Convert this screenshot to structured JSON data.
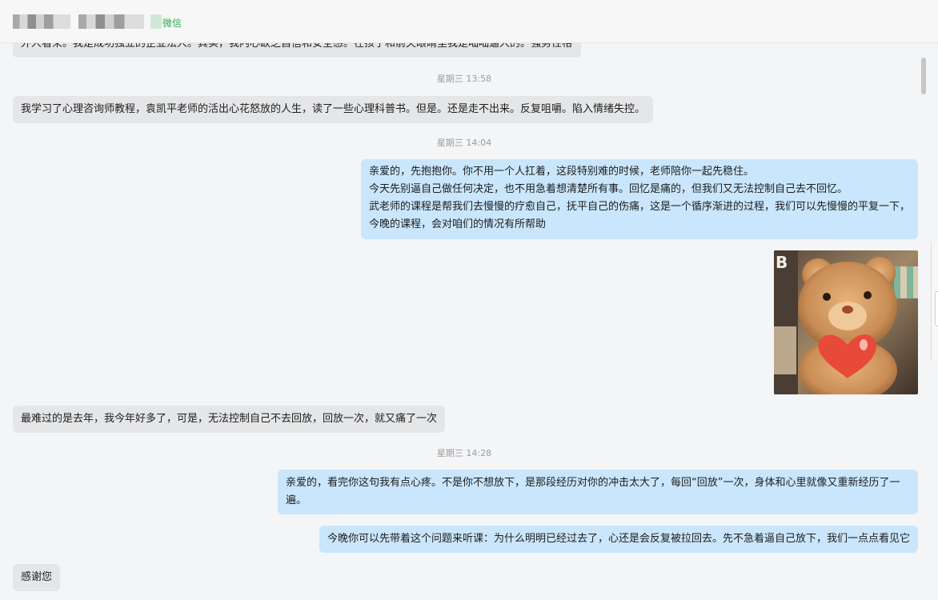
{
  "header": {
    "source_label": "微信"
  },
  "messages": {
    "m0": "外人看来。我是成功独立的企业法人。其实，我内心缺乏自信和安全感。在孩子和前夫眼睛里我是咄咄逼人的。强势性格",
    "t1": "星期三 13:58",
    "m1": "我学习了心理咨询师教程，袁凯平老师的活出心花怒放的人生，读了一些心理科普书。但是。还是走不出来。反复咀嚼。陷入情绪失控。",
    "t2": "星期三 14:04",
    "m2": "亲爱的，先抱抱你。你不用一个人扛着，这段特别难的时候，老师陪你一起先稳住。\n今天先别逼自己做任何决定，也不用急着想清楚所有事。回忆是痛的，但我们又无法控制自己去不回忆。\n武老师的课程是帮我们去慢慢的疗愈自己，抚平自己的伤痛，这是一个循序渐进的过程，我们可以先慢慢的平复一下，\n今晚的课程，会对咱们的情况有所帮助",
    "m3": "最难过的是去年，我今年好多了，可是，无法控制自己不去回放，回放一次，就又痛了一次",
    "t3": "星期三 14:28",
    "m4": "亲爱的，看完你这句我有点心疼。不是你不想放下，是那段经历对你的冲击太大了，每回“回放”一次，身体和心里就像又重新经历了一遍。",
    "m5": "今晚你可以先带着这个问题来听课：为什么明明已经过去了，心还是会反复被拉回去。先不急着逼自己放下，我们一点点看见它",
    "m6": "感谢您"
  },
  "sticker": {
    "description_icon": "teddy-bear-heart-sticker"
  },
  "colors": {
    "incoming_bubble": "#e5e6e8",
    "outgoing_bubble": "#c9e6fc",
    "source_green": "#2fa84f",
    "timestamp": "#9b9b9b"
  }
}
